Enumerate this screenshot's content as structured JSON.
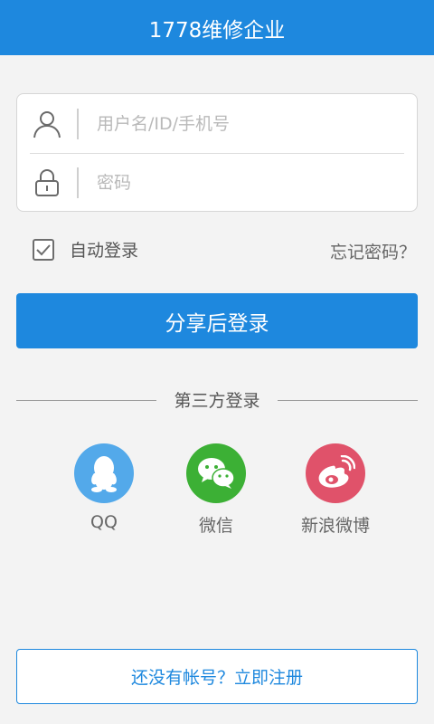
{
  "header": {
    "title": "1778维修企业"
  },
  "login_form": {
    "username": {
      "placeholder": "用户名/ID/手机号",
      "icon": "user-icon"
    },
    "password": {
      "placeholder": "密码",
      "icon": "lock-icon"
    }
  },
  "options": {
    "auto_login_label": "自动登录",
    "auto_login_checked": true,
    "forgot_password": "忘记密码？"
  },
  "login_button": {
    "label": "分享后登录"
  },
  "third_party": {
    "title": "第三方登录",
    "providers": [
      {
        "name": "QQ",
        "color": "#53a9ea",
        "icon": "qq-penguin-icon"
      },
      {
        "name": "微信",
        "color": "#3cb035",
        "icon": "wechat-icon"
      },
      {
        "name": "新浪微博",
        "color": "#e0526a",
        "icon": "weibo-icon"
      }
    ]
  },
  "register": {
    "label": "还没有帐号？立即注册"
  },
  "colors": {
    "primary": "#1e88de",
    "background": "#f3f3f3"
  }
}
